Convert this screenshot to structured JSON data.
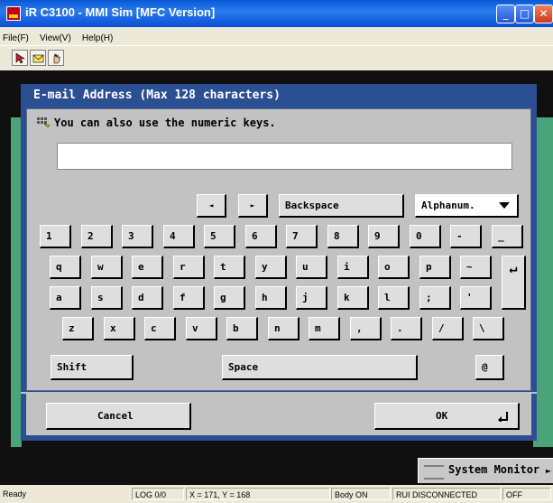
{
  "window": {
    "title": "iR C3100 - MMI Sim [MFC Version]",
    "buttons": [
      "_",
      "□",
      "✕"
    ]
  },
  "menu": [
    "File(F)",
    "View(V)",
    "Help(H)"
  ],
  "toolbar": {
    "icons": [
      "pointer-icon",
      "mail-icon",
      "hand-icon"
    ]
  },
  "dialog": {
    "title": "E-mail Address (Max 128 characters)",
    "hint": "You can also use the numeric keys.",
    "input_value": "",
    "nav_left": "◄",
    "nav_right": "►",
    "backspace": "Backspace",
    "mode_select": "Alphanum.",
    "rows": [
      [
        "1",
        "2",
        "3",
        "4",
        "5",
        "6",
        "7",
        "8",
        "9",
        "0",
        "-",
        "_"
      ],
      [
        "q",
        "w",
        "e",
        "r",
        "t",
        "y",
        "u",
        "i",
        "o",
        "p",
        "~"
      ],
      [
        "a",
        "s",
        "d",
        "f",
        "g",
        "h",
        "j",
        "k",
        "l",
        ";",
        "'"
      ],
      [
        "z",
        "x",
        "c",
        "v",
        "b",
        "n",
        "m",
        ",",
        ".",
        "/",
        "\\"
      ]
    ],
    "shift": "Shift",
    "space": "Space",
    "at": "@",
    "enter": "↵",
    "cancel": "Cancel",
    "ok": "OK"
  },
  "system_monitor": "System Monitor",
  "status": {
    "ready": "Ready",
    "log": "LOG 0/0",
    "coords": "X = 171, Y = 168",
    "body": "Body ON",
    "rui": "RUI DISCONNECTED",
    "off": "OFF"
  }
}
